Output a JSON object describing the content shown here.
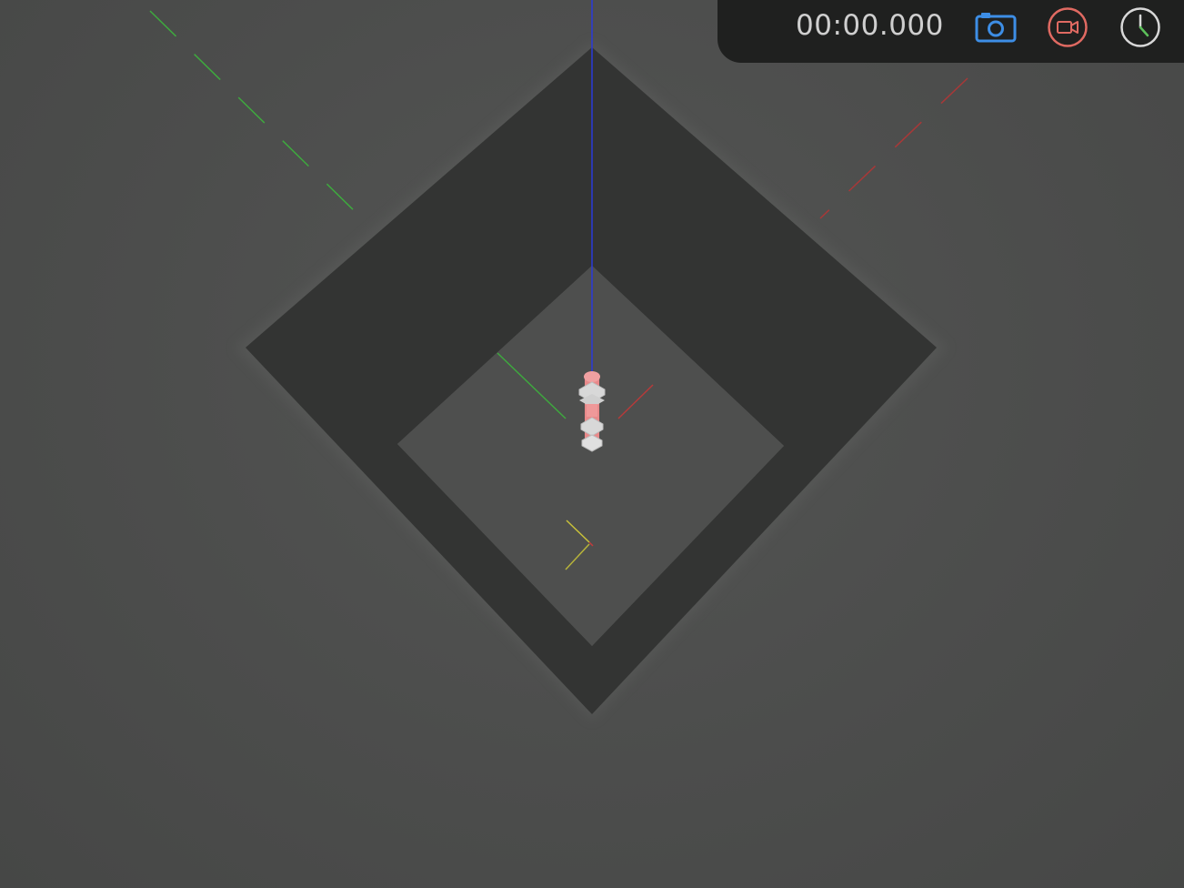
{
  "toolbar": {
    "timer": "00:00.000",
    "buttons": [
      {
        "name": "screenshot",
        "icon": "camera-icon",
        "color": "#3d8ee6"
      },
      {
        "name": "record",
        "icon": "video-camera-icon",
        "color": "#e06a62"
      },
      {
        "name": "clock",
        "icon": "clock-icon",
        "color": "#d8d8d8",
        "accent": "#5cc05a"
      }
    ]
  },
  "scene": {
    "background": "#4b4c4b",
    "wall_color": "#333433",
    "robot_color": "#e8898a",
    "axis_colors": {
      "x": "#c23b3b",
      "y": "#3ea93e",
      "z": "#2a3ad9",
      "marker": "#c9c23a"
    }
  }
}
